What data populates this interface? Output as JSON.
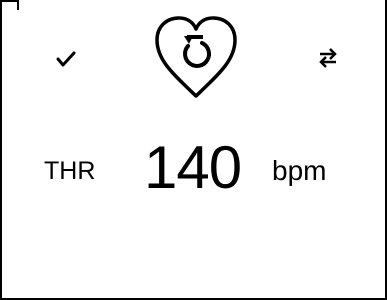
{
  "toolbar": {
    "confirm_icon": "checkmark-icon",
    "reset_icon": "heart-reset-icon",
    "swap_icon": "swap-arrows-icon"
  },
  "readout": {
    "label": "THR",
    "value": "140",
    "unit": "bpm"
  }
}
